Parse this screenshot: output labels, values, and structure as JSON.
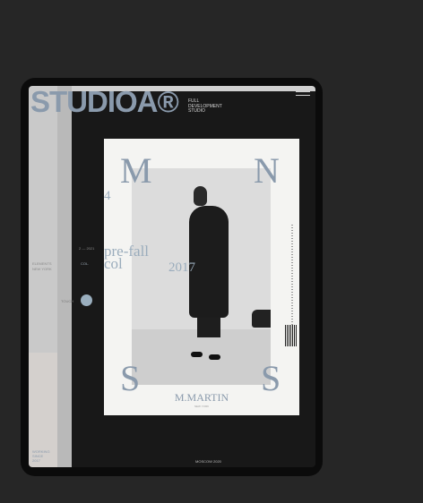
{
  "header": {
    "logo": "STUDIOA®",
    "subtitle": [
      "FULL",
      "DEVELOPMENT",
      "STUDIO"
    ]
  },
  "sidebar": {
    "left_labels": [
      "ELEMENTS",
      "NEW YORK"
    ],
    "bottom_labels": [
      "WORKING",
      "SINCE",
      "2017"
    ]
  },
  "middle": {
    "index": "2 — 2021",
    "col_label": "COL.",
    "touch_label": "TOUCH"
  },
  "poster": {
    "letters": [
      "M",
      "N",
      "S",
      "S"
    ],
    "number": "4",
    "year": "2017",
    "prefall": "pre-fall",
    "col": "col",
    "brand": "M.MARTIN",
    "brand_sub": "NEW YORK"
  },
  "footer": {
    "text": "MOSCOW 2020"
  },
  "icons": {
    "menu": "hamburger-menu-icon",
    "touch": "touch-dot-icon"
  },
  "colors": {
    "accent": "#8a9aac",
    "background": "#262626"
  }
}
